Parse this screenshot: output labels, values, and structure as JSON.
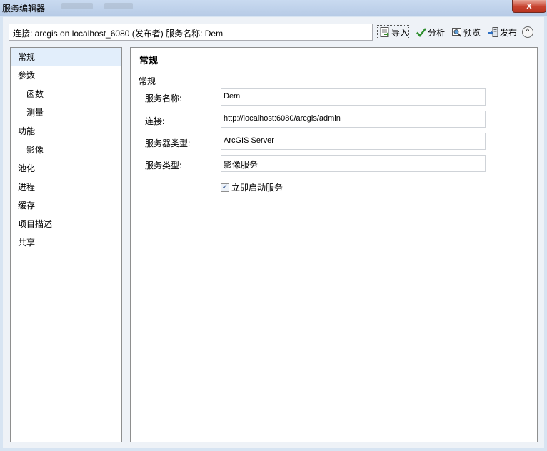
{
  "window": {
    "title": "服务编辑器",
    "close_glyph": "x"
  },
  "toolbar": {
    "connection_text": "连接: arcgis on localhost_6080 (发布者)   服务名称: Dem",
    "import_label": "导入",
    "analyze_label": "分析",
    "preview_label": "预览",
    "publish_label": "发布",
    "collapse_glyph": "^"
  },
  "sidebar": {
    "items": [
      {
        "label": "常规"
      },
      {
        "label": "参数"
      },
      {
        "label": "函数"
      },
      {
        "label": "测量"
      },
      {
        "label": "功能"
      },
      {
        "label": "影像"
      },
      {
        "label": "池化"
      },
      {
        "label": "进程"
      },
      {
        "label": "缓存"
      },
      {
        "label": "项目描述"
      },
      {
        "label": "共享"
      }
    ]
  },
  "content": {
    "title": "常规",
    "group_label": "常规",
    "fields": [
      {
        "label": "服务名称:",
        "value": "Dem"
      },
      {
        "label": "连接:",
        "value": "http://localhost:6080/arcgis/admin"
      },
      {
        "label": "服务器类型:",
        "value": "ArcGIS Server"
      },
      {
        "label": "服务类型:",
        "value": "影像服务"
      }
    ],
    "start_checkbox": {
      "label": "立即启动服务",
      "checked": true,
      "check_glyph": "✓"
    }
  },
  "colors": {
    "window_frame": "#d7e4f2",
    "selected_item": "#e2eefb",
    "close_button": "#c7432f"
  }
}
